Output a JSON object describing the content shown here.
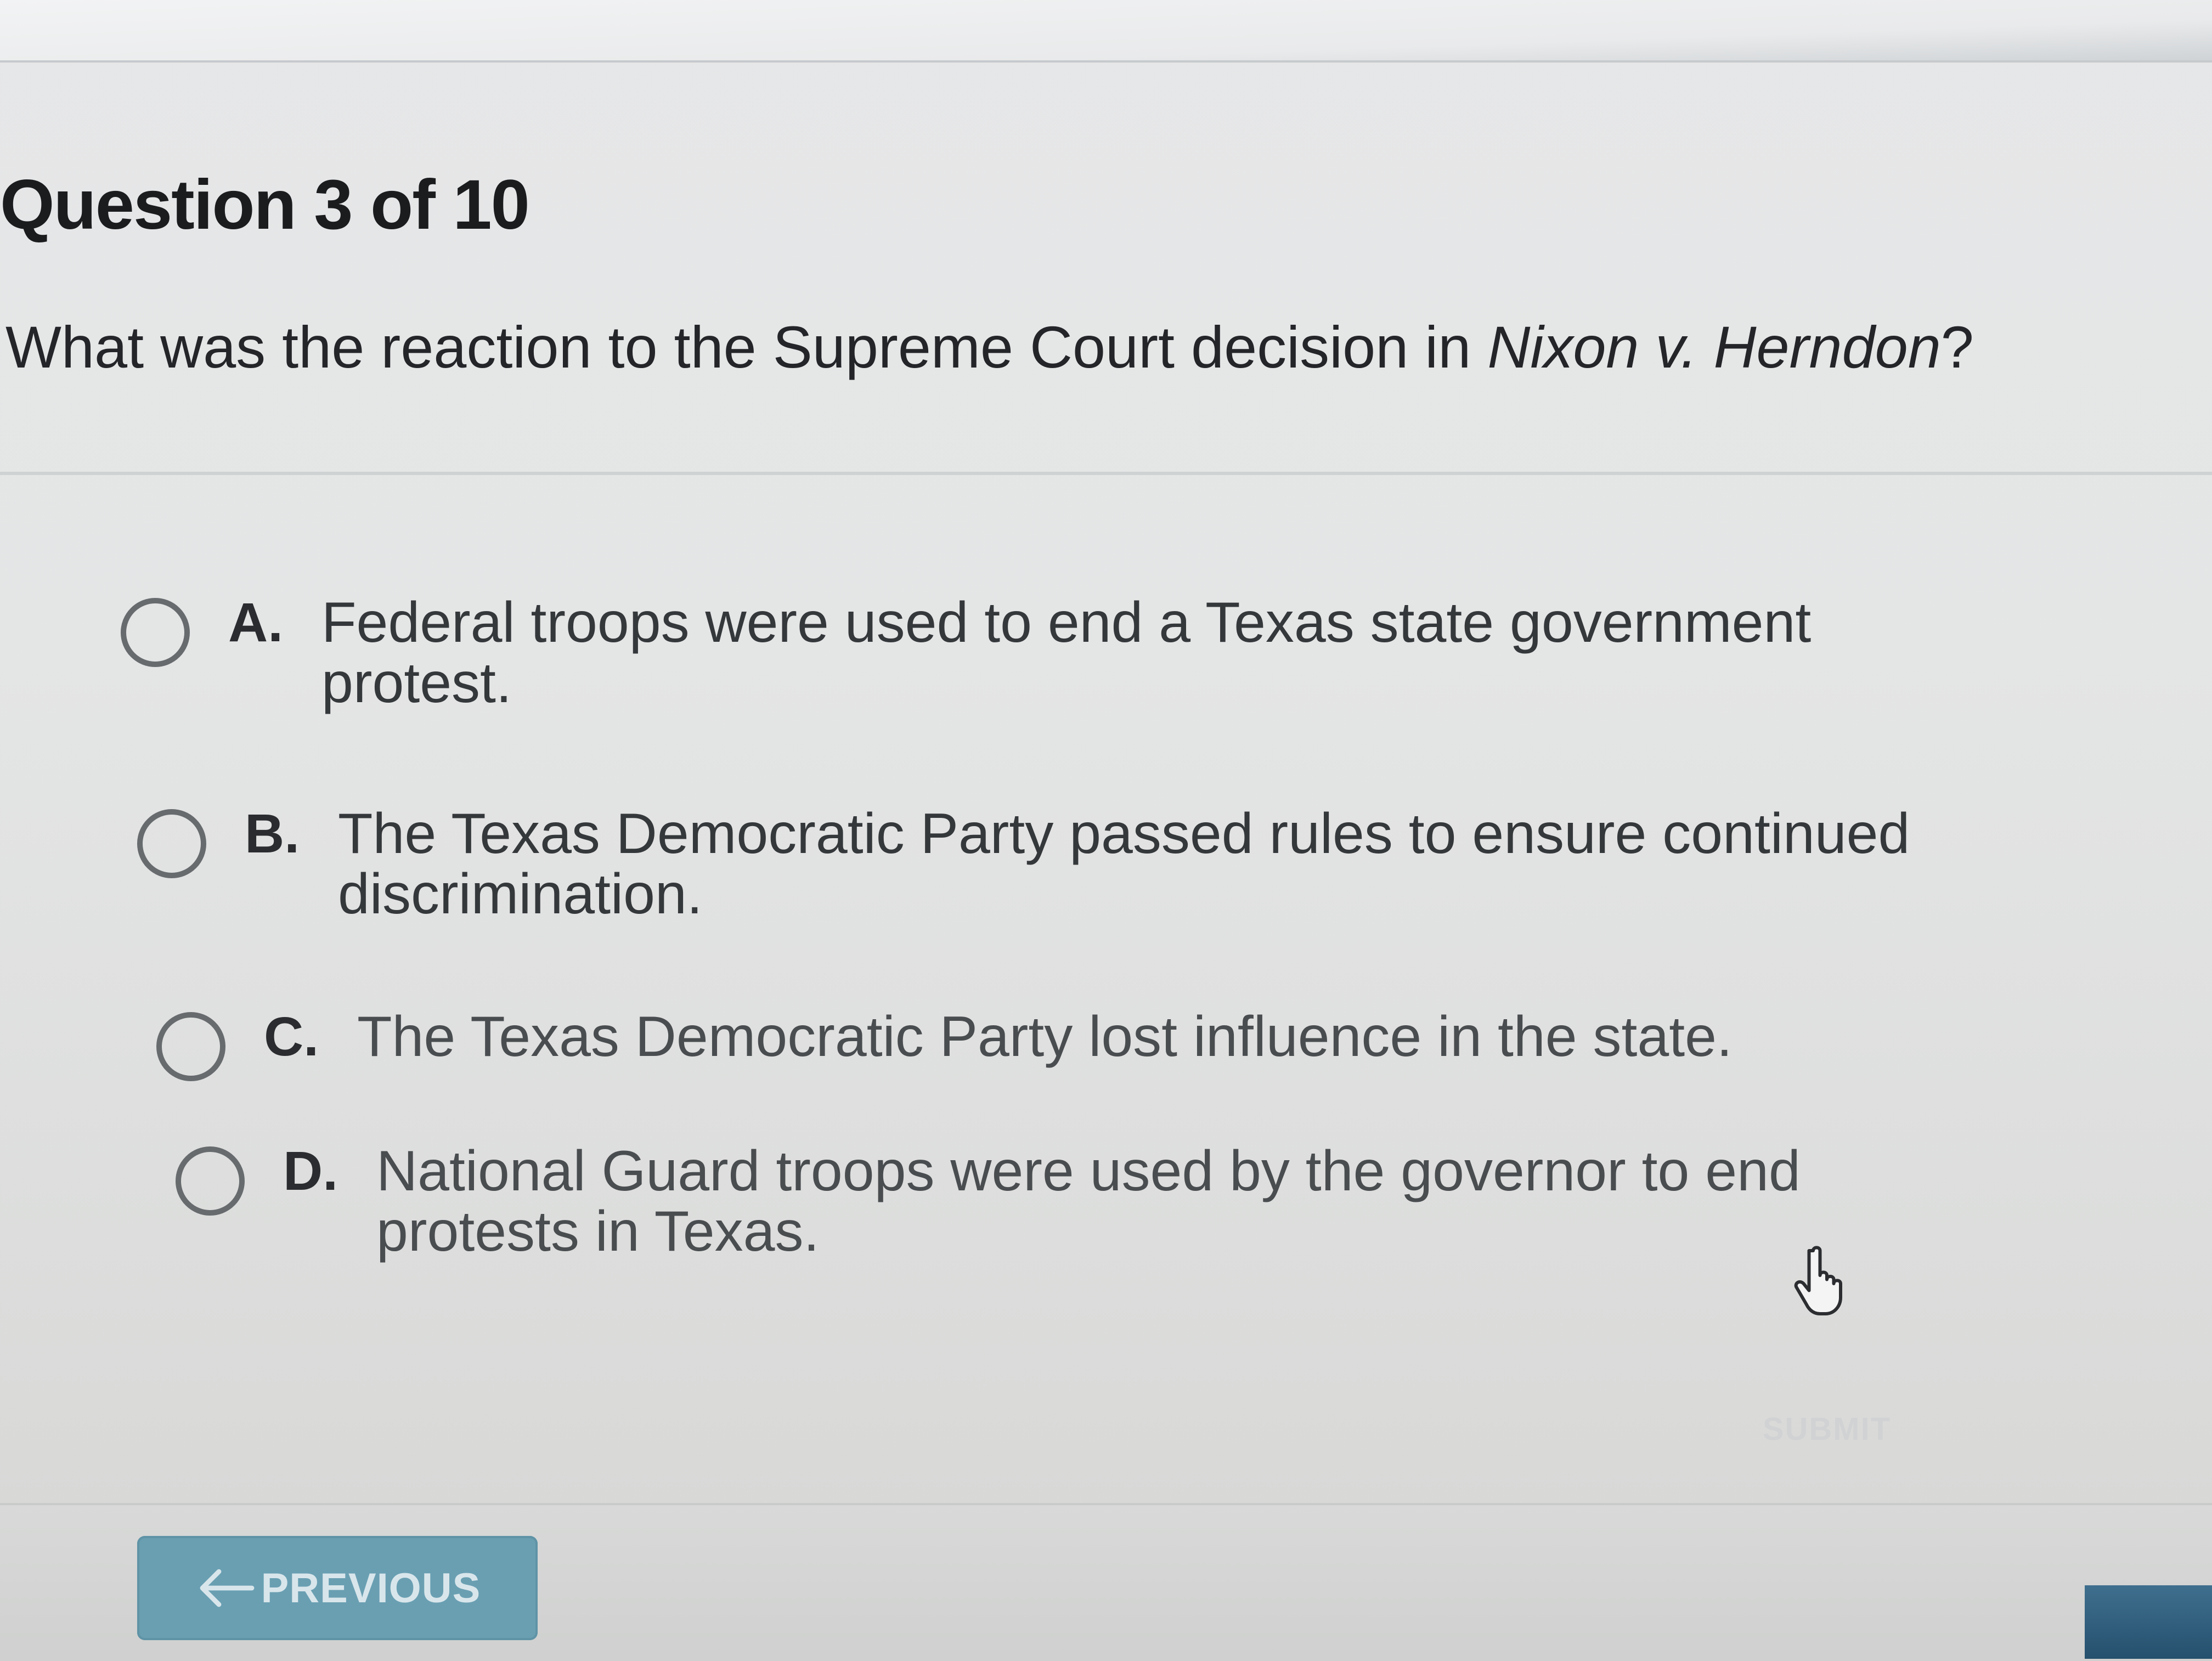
{
  "quiz": {
    "counter": "Question 3 of 10",
    "question_prefix": "What was the reaction to the Supreme Court decision in ",
    "question_case": "Nixon v. Herndon",
    "question_suffix": "?"
  },
  "options": [
    {
      "letter": "A.",
      "text": "Federal troops were used to end a Texas state government protest."
    },
    {
      "letter": "B.",
      "text": "The Texas Democratic Party passed rules to ensure continued discrimination."
    },
    {
      "letter": "C.",
      "text": "The Texas Democratic Party lost influence in the state."
    },
    {
      "letter": "D.",
      "text": "National Guard troops were used by the governor to end protests in Texas."
    }
  ],
  "footer": {
    "submit_label": "SUBMIT",
    "previous_label": "PREVIOUS"
  },
  "icons": {
    "radio": "radio-unselected-icon",
    "cursor": "hand-pointer-icon",
    "back": "arrow-left-icon"
  },
  "colors": {
    "previous_button": "#6a9fb2",
    "radio_border": "#676b6e",
    "submit_disabled": "#d0d2d3"
  }
}
